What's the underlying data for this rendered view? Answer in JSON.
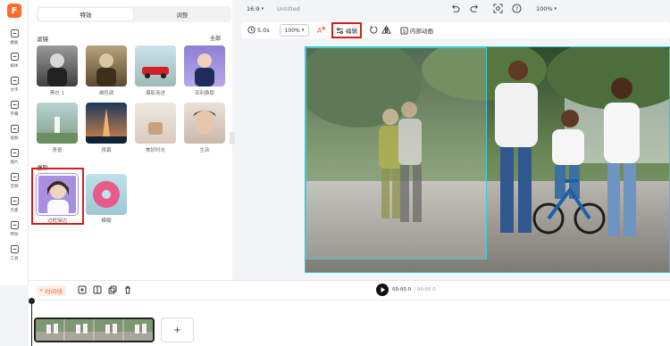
{
  "app": {
    "logo_letter": "F",
    "file_title": "Untitled",
    "brand_color": "#ff6b2c"
  },
  "rail": [
    {
      "label": "模板",
      "icon": "template-icon"
    },
    {
      "label": "媒体",
      "icon": "media-icon"
    },
    {
      "label": "文字",
      "icon": "text-icon"
    },
    {
      "label": "字幕",
      "icon": "subtitle-icon"
    },
    {
      "label": "视频",
      "icon": "video-icon"
    },
    {
      "label": "图片",
      "icon": "image-icon"
    },
    {
      "label": "音频",
      "icon": "audio-icon"
    },
    {
      "label": "元素",
      "icon": "elements-icon"
    },
    {
      "label": "特效",
      "icon": "effects-icon"
    },
    {
      "label": "工具",
      "icon": "tools-icon"
    }
  ],
  "panel": {
    "tabs": [
      "特效",
      "调整"
    ],
    "filters_title": "滤镜",
    "all_link": "全部",
    "filters": [
      "黑白 1",
      "褐色调",
      "爆影渐进",
      "亚利桑那",
      "青瓷",
      "夜幕",
      "美好时光",
      "生动"
    ],
    "advanced_title": "进阶",
    "advanced": [
      "边框描边",
      "模糊"
    ]
  },
  "topbar": {
    "aspect": "16:9",
    "zoom": "100%"
  },
  "toolbar": {
    "duration": "5.0s",
    "scale": "100%",
    "edit_label": "编辑",
    "animation_label": "内部动画"
  },
  "timeline": {
    "label": "时间线",
    "current_time": "00:00.0",
    "total_time": "/ 00:05.0",
    "add": "+"
  },
  "colors": {
    "highlight": "#d21f1f",
    "guide": "#39d0db"
  }
}
